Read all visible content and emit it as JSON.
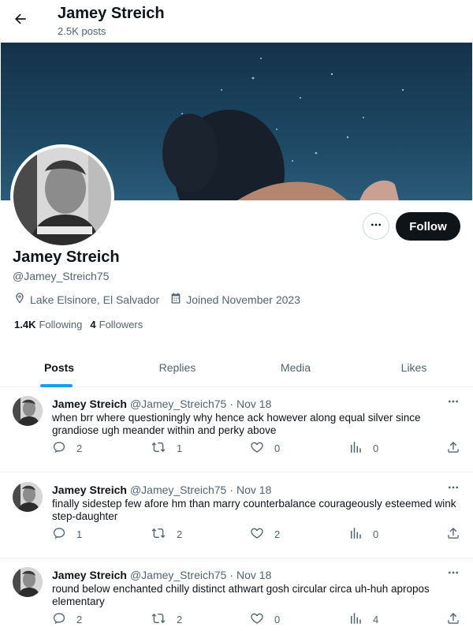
{
  "header": {
    "name": "Jamey Streich",
    "post_count": "2.5K posts"
  },
  "profile": {
    "name": "Jamey Streich",
    "handle": "@Jamey_Streich75",
    "location": "Lake Elsinore, El Salvador",
    "joined": "Joined November 2023",
    "following_count": "1.4K",
    "following_label": "Following",
    "followers_count": "4",
    "followers_label": "Followers",
    "follow_label": "Follow"
  },
  "tabs": [
    {
      "label": "Posts",
      "active": true
    },
    {
      "label": "Replies",
      "active": false
    },
    {
      "label": "Media",
      "active": false
    },
    {
      "label": "Likes",
      "active": false
    }
  ],
  "posts": [
    {
      "author": "Jamey Streich",
      "handle": "@Jamey_Streich75",
      "time": "Nov 18",
      "text": "when brr where questioningly why hence ack however along equal silver since grandiose ugh meander within and perky above",
      "replies": "2",
      "reposts": "1",
      "likes": "0",
      "views": "0"
    },
    {
      "author": "Jamey Streich",
      "handle": "@Jamey_Streich75",
      "time": "Nov 18",
      "text": "finally sidestep few afore hm than marry counterbalance courageously esteemed wink step-daughter",
      "replies": "1",
      "reposts": "2",
      "likes": "2",
      "views": "0"
    },
    {
      "author": "Jamey Streich",
      "handle": "@Jamey_Streich75",
      "time": "Nov 18",
      "text": "round below enchanted chilly distinct athwart gosh circular circa uh-huh apropos elementary",
      "replies": "2",
      "reposts": "2",
      "likes": "0",
      "views": "4"
    }
  ],
  "icons": {
    "back": "arrow-left-icon",
    "more": "more-horizontal-icon",
    "location": "location-pin-icon",
    "calendar": "calendar-icon",
    "reply": "reply-icon",
    "repost": "repost-icon",
    "like": "heart-icon",
    "views": "views-chart-icon",
    "share": "share-icon"
  },
  "colors": {
    "accent": "#1d9bf0",
    "text": "#0f1419",
    "secondary": "#536471",
    "follow_button": "#0f1419"
  }
}
